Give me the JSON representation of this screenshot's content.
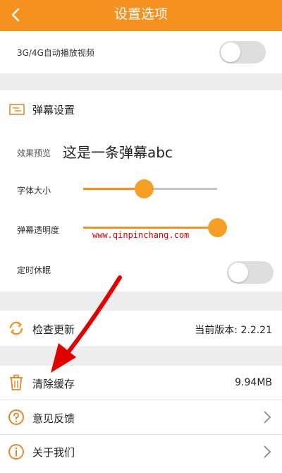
{
  "header": {
    "title": "设置选项"
  },
  "settings": {
    "autoplay_label": "3G/4G自动播放视频",
    "danmaku_title": "弹幕设置",
    "preview_label": "效果预览",
    "preview_text": "这是一条弹幕abc",
    "font_size_label": "字体大小",
    "font_size_value": 0.45,
    "opacity_label": "弹幕透明度",
    "opacity_value": 1.0,
    "sleep_timer_label": "定时休眠"
  },
  "menu": {
    "check_update_label": "检查更新",
    "version_text": "当前版本: 2.2.21",
    "clear_cache_label": "清除缓存",
    "cache_size": "9.94MB",
    "feedback_label": "意见反馈",
    "about_label": "关于我们"
  },
  "watermark": "www.qinpinchang.com",
  "colors": {
    "accent": "#f5911e",
    "annotation_arrow": "#e00000"
  },
  "icons": [
    "back-icon",
    "danmaku-icon",
    "refresh-icon",
    "trash-icon",
    "question-icon",
    "info-icon",
    "chevron-right-icon"
  ]
}
